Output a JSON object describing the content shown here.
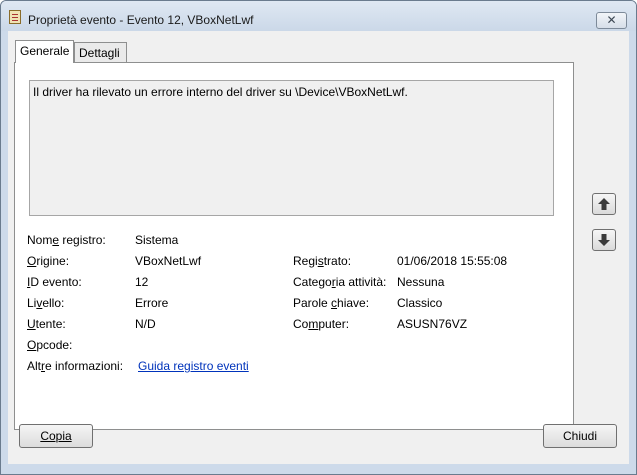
{
  "window": {
    "title": "Proprietà evento - Evento 12, VBoxNetLwf",
    "close_glyph": "✕"
  },
  "tabs": [
    {
      "label": "Generale",
      "active": true
    },
    {
      "label": "Dettagli",
      "active": false
    }
  ],
  "description": "Il driver ha rilevato un errore interno del driver su \\Device\\VBoxNetLwf.",
  "fields": {
    "log_name": {
      "label": "Nome registro:",
      "value": "Sistema"
    },
    "source": {
      "label": "Origine:",
      "value": "VBoxNetLwf"
    },
    "logged": {
      "label": "Registrato:",
      "value": "01/06/2018 15:55:08"
    },
    "event_id": {
      "label": "ID evento:",
      "value": "12"
    },
    "task_category": {
      "label": "Categoria attività:",
      "value": "Nessuna"
    },
    "level": {
      "label": "Livello:",
      "value": "Errore"
    },
    "keywords": {
      "label": "Parole chiave:",
      "value": "Classico"
    },
    "user": {
      "label": "Utente:",
      "value": "N/D"
    },
    "computer": {
      "label": "Computer:",
      "value": "ASUSN76VZ"
    },
    "opcode": {
      "label": "Opcode:",
      "value": ""
    },
    "more_info": {
      "label": "Altre informazioni:",
      "link": "Guida registro eventi"
    }
  },
  "buttons": {
    "copy": "Copia",
    "close": "Chiudi"
  },
  "icons": {
    "up": "arrow-up-icon",
    "down": "arrow-down-icon"
  }
}
